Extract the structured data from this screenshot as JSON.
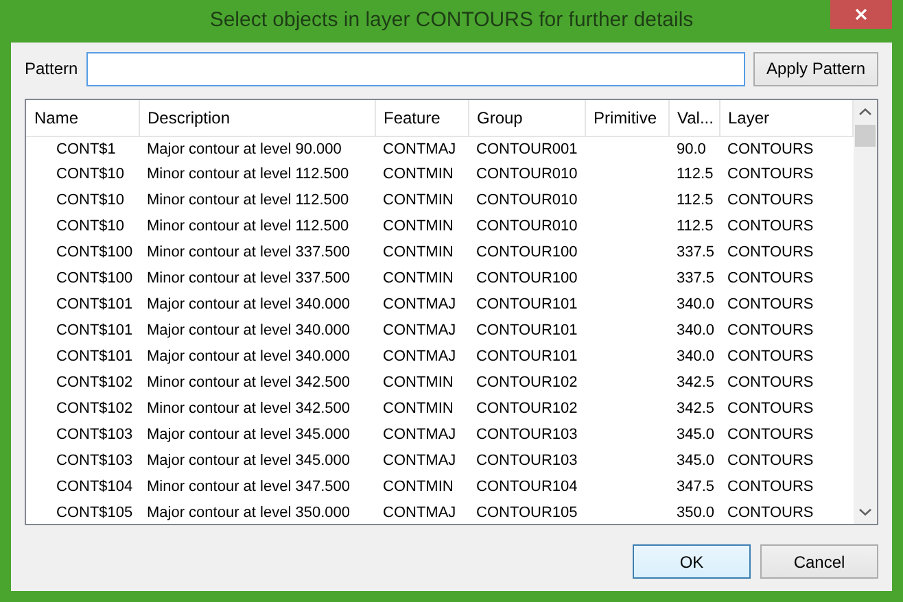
{
  "window": {
    "title": "Select objects in layer CONTOURS for further details"
  },
  "pattern": {
    "label": "Pattern",
    "button": "Apply Pattern"
  },
  "table": {
    "columns": [
      "Name",
      "Description",
      "Feature",
      "Group",
      "Primitive",
      "Val...",
      "Layer"
    ],
    "rows": [
      [
        "CONT$1",
        "Major contour at level 90.000",
        "CONTMAJ",
        "CONTOUR001",
        "",
        "90.0",
        "CONTOURS"
      ],
      [
        "CONT$10",
        "Minor contour at level 112.500",
        "CONTMIN",
        "CONTOUR010",
        "",
        "112.5",
        "CONTOURS"
      ],
      [
        "CONT$10",
        "Minor contour at level 112.500",
        "CONTMIN",
        "CONTOUR010",
        "",
        "112.5",
        "CONTOURS"
      ],
      [
        "CONT$10",
        "Minor contour at level 112.500",
        "CONTMIN",
        "CONTOUR010",
        "",
        "112.5",
        "CONTOURS"
      ],
      [
        "CONT$100",
        "Minor contour at level 337.500",
        "CONTMIN",
        "CONTOUR100",
        "",
        "337.5",
        "CONTOURS"
      ],
      [
        "CONT$100",
        "Minor contour at level 337.500",
        "CONTMIN",
        "CONTOUR100",
        "",
        "337.5",
        "CONTOURS"
      ],
      [
        "CONT$101",
        "Major contour at level 340.000",
        "CONTMAJ",
        "CONTOUR101",
        "",
        "340.0",
        "CONTOURS"
      ],
      [
        "CONT$101",
        "Major contour at level 340.000",
        "CONTMAJ",
        "CONTOUR101",
        "",
        "340.0",
        "CONTOURS"
      ],
      [
        "CONT$101",
        "Major contour at level 340.000",
        "CONTMAJ",
        "CONTOUR101",
        "",
        "340.0",
        "CONTOURS"
      ],
      [
        "CONT$102",
        "Minor contour at level 342.500",
        "CONTMIN",
        "CONTOUR102",
        "",
        "342.5",
        "CONTOURS"
      ],
      [
        "CONT$102",
        "Minor contour at level 342.500",
        "CONTMIN",
        "CONTOUR102",
        "",
        "342.5",
        "CONTOURS"
      ],
      [
        "CONT$103",
        "Major contour at level 345.000",
        "CONTMAJ",
        "CONTOUR103",
        "",
        "345.0",
        "CONTOURS"
      ],
      [
        "CONT$103",
        "Major contour at level 345.000",
        "CONTMAJ",
        "CONTOUR103",
        "",
        "345.0",
        "CONTOURS"
      ],
      [
        "CONT$104",
        "Minor contour at level 347.500",
        "CONTMIN",
        "CONTOUR104",
        "",
        "347.5",
        "CONTOURS"
      ],
      [
        "CONT$105",
        "Major contour at level 350.000",
        "CONTMAJ",
        "CONTOUR105",
        "",
        "350.0",
        "CONTOURS"
      ]
    ]
  },
  "buttons": [
    {
      "label": "OK",
      "selected": true
    },
    {
      "label": "Cancel",
      "selected": false
    }
  ]
}
